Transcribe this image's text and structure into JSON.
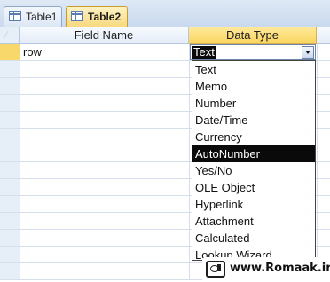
{
  "tabs": [
    {
      "label": "Table1",
      "active": false
    },
    {
      "label": "Table2",
      "active": true
    }
  ],
  "grid": {
    "headers": {
      "field_name": "Field Name",
      "data_type": "Data Type"
    },
    "rows": [
      {
        "field_name": "row",
        "data_type": "Text"
      }
    ]
  },
  "combo": {
    "value": "Text"
  },
  "dropdown": {
    "options": [
      "Text",
      "Memo",
      "Number",
      "Date/Time",
      "Currency",
      "AutoNumber",
      "Yes/No",
      "OLE Object",
      "Hyperlink",
      "Attachment",
      "Calculated",
      "Lookup Wizard"
    ],
    "highlighted": "AutoNumber"
  },
  "watermark": {
    "text": "www.Romaak.ir"
  },
  "colors": {
    "highlight": "#0a0a0a",
    "active_tab": "#f7d87a",
    "header_selected": "#f9d45e"
  }
}
